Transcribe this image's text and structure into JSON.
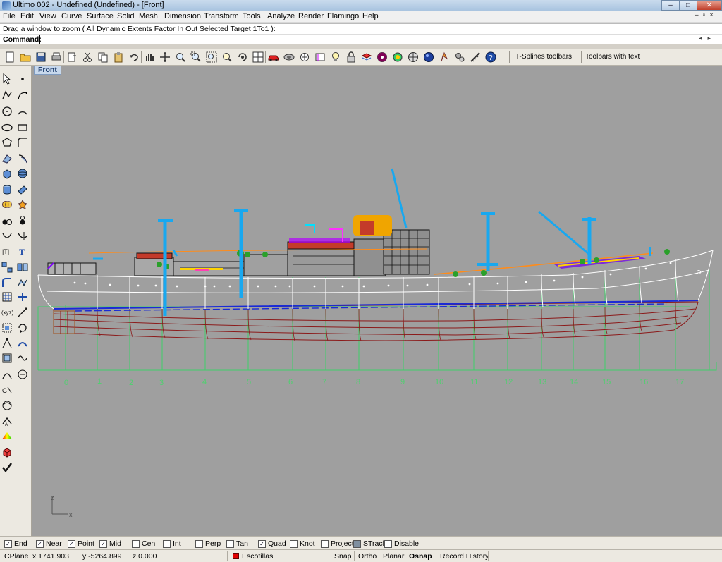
{
  "window": {
    "title": "Ultimo 002 - Undefined (Undefined) - [Front]",
    "min_label": "–",
    "max_label": "□",
    "close_label": "✕"
  },
  "menu": {
    "items": [
      "File",
      "Edit",
      "View",
      "Curve",
      "Surface",
      "Solid",
      "Mesh",
      "Dimension",
      "Transform",
      "Tools",
      "Analyze",
      "Render",
      "Flamingo",
      "Help"
    ]
  },
  "command": {
    "history": "Drag a window to zoom ( All  Dynamic  Extents  Factor  In  Out  Selected  Target  1To1 ):",
    "prompt_label": "Command:",
    "input_value": ""
  },
  "toolbar": {
    "icons": [
      "new-file-icon",
      "open-file-icon",
      "save-icon",
      "print-icon",
      "import-icon",
      "cut-icon",
      "copy-icon",
      "paste-icon",
      "undo-icon",
      "pan-hand-icon",
      "move-view-icon",
      "zoom-icon",
      "zoom-window-icon",
      "zoom-extents-icon",
      "zoom-selected-icon",
      "rotate-view-icon",
      "four-viewports-icon",
      "car-icon",
      "pipe-icon",
      "camera-icon",
      "snapshot-icon",
      "light-bulb-icon",
      "lock-icon",
      "layer-icon",
      "color-wheel-icon",
      "material-icon",
      "grid-icon",
      "render-sphere-icon",
      "flamingo-icon",
      "settings-gears-icon",
      "measure-icon",
      "help-icon"
    ],
    "tsplines_label": "T-Splines toolbars",
    "toolbars_text_label": "Toolbars with text"
  },
  "leftbar": {
    "icons": [
      "select-arrow-icon",
      "point-icon",
      "polyline-icon",
      "curve-control-points-icon",
      "circle-icon",
      "arc-icon",
      "ellipse-icon",
      "rectangle-icon",
      "polygon-icon",
      "fillet-curve-icon",
      "surface-corner-icon",
      "extrude-curve-icon",
      "box-icon",
      "sphere-icon",
      "cylinder-icon",
      "mesh-plane-icon",
      "boolean-union-icon",
      "explode-icon",
      "join-icon",
      "split-icon",
      "trim-icon",
      "group-icon",
      "dimension-icon",
      "text-icon",
      "array-icon",
      "mirror-icon",
      "fillet-edge-icon",
      "surface-from-curves-icon",
      "grid-cage-icon",
      "transform-icon",
      "xyz-point-icon",
      "move-icon",
      "scale-icon",
      "rotate-icon",
      "orient-icon",
      "flow-icon",
      "cage-edit-icon",
      "twist-icon",
      "bend-icon",
      "rebuild-icon",
      "analyze-direction-icon",
      "zebra-icon",
      "curvature-graph-icon",
      "environment-map-icon",
      "draft-angle-icon",
      "check-icon"
    ],
    "xyz_label": "xyz"
  },
  "viewport": {
    "tab_label": "Front",
    "background_color": "#9f9f9f",
    "station_labels": [
      "0",
      "1",
      "2",
      "3",
      "4",
      "5",
      "6",
      "7",
      "8",
      "9",
      "10",
      "11",
      "12",
      "13",
      "14",
      "15",
      "16",
      "17"
    ],
    "axis_z_label": "z",
    "axis_x_label": "x"
  },
  "osnap": {
    "items": [
      {
        "label": "End",
        "checked": true
      },
      {
        "label": "Near",
        "checked": true
      },
      {
        "label": "Point",
        "checked": true
      },
      {
        "label": "Mid",
        "checked": true
      },
      {
        "label": "Cen",
        "checked": false
      },
      {
        "label": "Int",
        "checked": false
      },
      {
        "label": "Perp",
        "checked": false
      },
      {
        "label": "Tan",
        "checked": false
      },
      {
        "label": "Quad",
        "checked": true
      },
      {
        "label": "Knot",
        "checked": false
      },
      {
        "label": "Project",
        "checked": false
      },
      {
        "label": "STrack",
        "checked": true
      },
      {
        "label": "Disable",
        "checked": false
      }
    ]
  },
  "status": {
    "cplane_label": "CPlane",
    "x_coord": "x 1741.903",
    "y_coord": "y -5264.899",
    "z_coord": "z 0.000",
    "layer_name": "Escotillas",
    "layer_color": "#e00000",
    "snap_label": "Snap",
    "ortho_label": "Ortho",
    "planar_label": "Planar",
    "osnap_label": "Osnap",
    "record_history_label": "Record History"
  }
}
